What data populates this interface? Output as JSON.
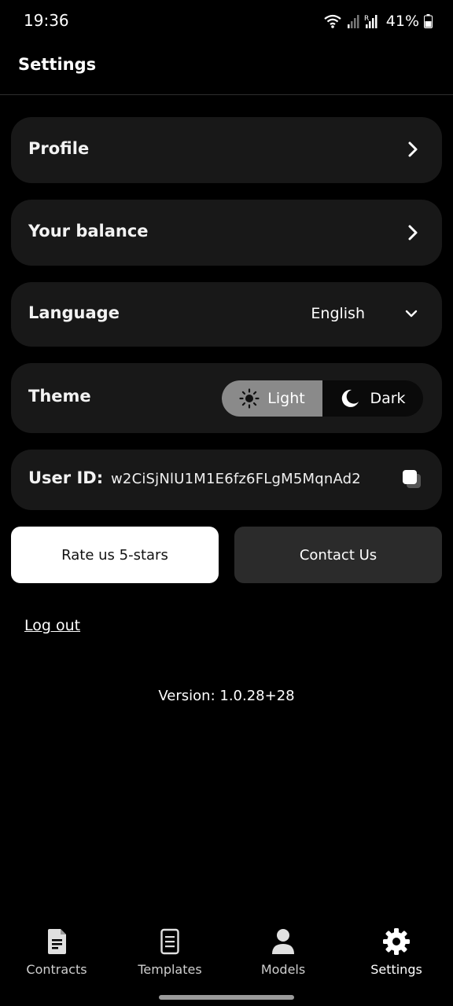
{
  "status_bar": {
    "time": "19:36",
    "battery": "41%",
    "icons": [
      "wifi-icon",
      "signal-icon",
      "signal-roaming-icon",
      "battery-icon"
    ]
  },
  "header": {
    "title": "Settings"
  },
  "settings": {
    "profile": {
      "label": "Profile",
      "icon": "chevron-right-icon"
    },
    "balance": {
      "label": "Your balance",
      "icon": "chevron-right-icon"
    },
    "language": {
      "label": "Language",
      "value": "English",
      "icon": "chevron-down-icon"
    },
    "theme": {
      "label": "Theme",
      "options": [
        {
          "label": "Light",
          "icon": "sun-icon"
        },
        {
          "label": "Dark",
          "icon": "moon-icon"
        }
      ],
      "selected": "Light"
    },
    "user_id": {
      "label": "User ID:",
      "value": "w2CiSjNlU1M1E6fz6FLgM5MqnAd2",
      "icon": "copy-icon"
    }
  },
  "buttons": {
    "rate": "Rate us 5-stars",
    "contact": "Contact Us"
  },
  "logout": "Log out",
  "version": "Version: 1.0.28+28",
  "bottom_nav": {
    "items": [
      {
        "label": "Contracts",
        "icon": "contract-document-icon"
      },
      {
        "label": "Templates",
        "icon": "template-document-icon"
      },
      {
        "label": "Models",
        "icon": "person-icon"
      },
      {
        "label": "Settings",
        "icon": "gear-icon"
      }
    ],
    "active": "Settings"
  },
  "colors": {
    "background": "#000000",
    "card": "#181818",
    "toggle_active": "#8a8a8a",
    "primary_button": "#ffffff",
    "secondary_button": "#2b2b2b"
  }
}
